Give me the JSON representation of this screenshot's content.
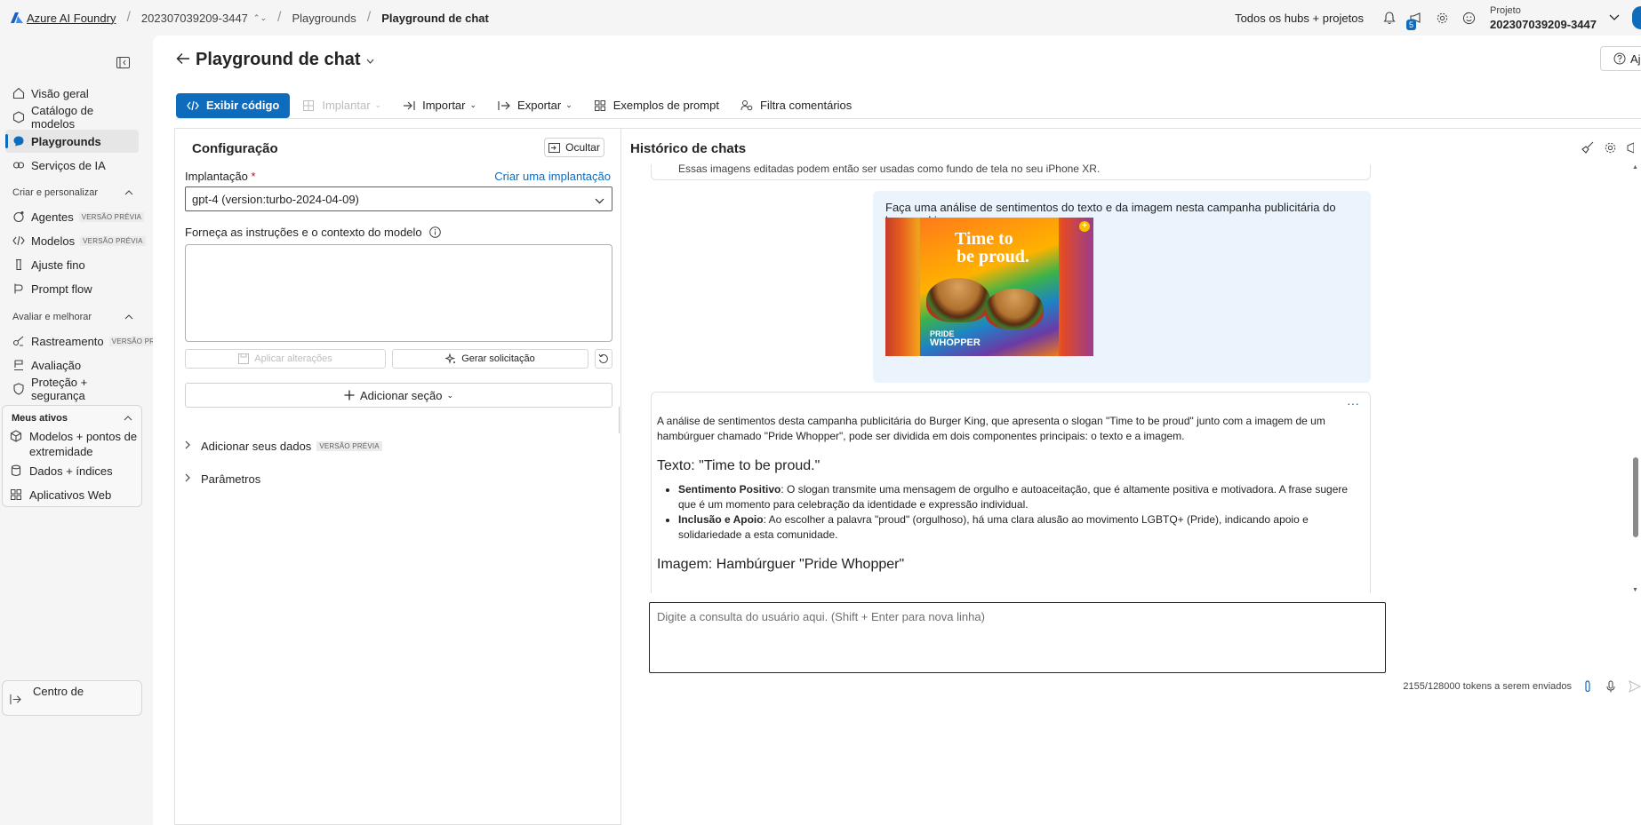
{
  "topbar": {
    "brand": "Azure AI Foundry",
    "project_crumb": "202307039209-3447",
    "crumb_playgrounds": "Playgrounds",
    "crumb_current": "Playground de chat",
    "hubs_link": "Todos os hubs + projetos",
    "notif_count": "5",
    "project_label": "Projeto",
    "project_name": "202307039209-3447"
  },
  "sidebar": {
    "items": [
      {
        "label": "Visão geral",
        "icon": "home-icon"
      },
      {
        "label": "Catálogo de modelos",
        "icon": "catalog-icon"
      },
      {
        "label": "Playgrounds",
        "icon": "chat-icon"
      },
      {
        "label": "Serviços de IA",
        "icon": "ai-services-icon"
      }
    ],
    "section_create": "Criar e personalizar",
    "create_items": [
      {
        "label": "Agentes",
        "tag": "VERSÃO PRÉVIA"
      },
      {
        "label": "Modelos",
        "tag": "VERSÃO PRÉVIA"
      },
      {
        "label": "Ajuste fino"
      },
      {
        "label": "Prompt flow"
      }
    ],
    "section_eval": "Avaliar e melhorar",
    "eval_items": [
      {
        "label": "Rastreamento",
        "tag": "VERSÃO PRÉ"
      },
      {
        "label": "Avaliação"
      },
      {
        "label": "Proteção + segurança"
      }
    ],
    "section_assets": "Meus ativos",
    "asset_items": [
      {
        "label": "Modelos + pontos de extremidade"
      },
      {
        "label": "Dados + índices"
      },
      {
        "label": "Aplicativos Web"
      }
    ],
    "bottom_item": "Centro de"
  },
  "page": {
    "title": "Playground de chat",
    "help": "Aju"
  },
  "toolbar": {
    "view_code": "Exibir código",
    "deploy": "Implantar",
    "import": "Importar",
    "export": "Exportar",
    "prompt_samples": "Exemplos de prompt",
    "feedback_filter": "Filtra comentários"
  },
  "config": {
    "title": "Configuração",
    "hide": "Ocultar",
    "deployment_label": "Implantação",
    "required_mark": "*",
    "create_deployment": "Criar uma implantação",
    "deployment_value": "gpt-4 (version:turbo-2024-04-09)",
    "instructions_label": "Forneça as instruções e o contexto do modelo",
    "apply_changes": "Aplicar alterações",
    "generate_prompt": "Gerar solicitação",
    "add_section": "Adicionar seção",
    "add_data": "Adicionar seus dados",
    "add_data_tag": "VERSÃO PRÉVIA",
    "parameters": "Parâmetros"
  },
  "chat": {
    "title": "Histórico de chats",
    "prev_message": "Essas imagens editadas podem então ser usadas como fundo de tela no seu iPhone XR.",
    "user_message": "Faça uma análise de sentimentos do texto e da imagem nesta campanha publicitária do burguer king.",
    "image_text_line1": "Time to",
    "image_text_line2": "be proud.",
    "image_text_pride": "PRIDE",
    "image_text_whopper": "WHOPPER",
    "assistant": {
      "intro": "A análise de sentimentos desta campanha publicitária do Burger King, que apresenta o slogan \"Time to be proud\" junto com a imagem de um hambúrguer chamado \"Pride Whopper\", pode ser dividida em dois componentes principais: o texto e a imagem.",
      "h_text": "Texto: \"Time to be proud.\"",
      "b1_title": "Sentimento Positivo",
      "b1_text": ": O slogan transmite uma mensagem de orgulho e autoaceitação, que é altamente positiva e motivadora. A frase sugere que é um momento para celebração da identidade e expressão individual.",
      "b2_title": "Inclusão e Apoio",
      "b2_text": ": Ao escolher a palavra \"proud\" (orgulhoso), há uma clara alusão ao movimento LGBTQ+ (Pride), indicando apoio e solidariedade a esta comunidade.",
      "h_image": "Imagem: Hambúrguer \"Pride Whopper\""
    },
    "input_placeholder": "Digite a consulta do usuário aqui. (Shift + Enter para nova linha)",
    "tokens": "2155/128000 tokens a serem enviados"
  }
}
